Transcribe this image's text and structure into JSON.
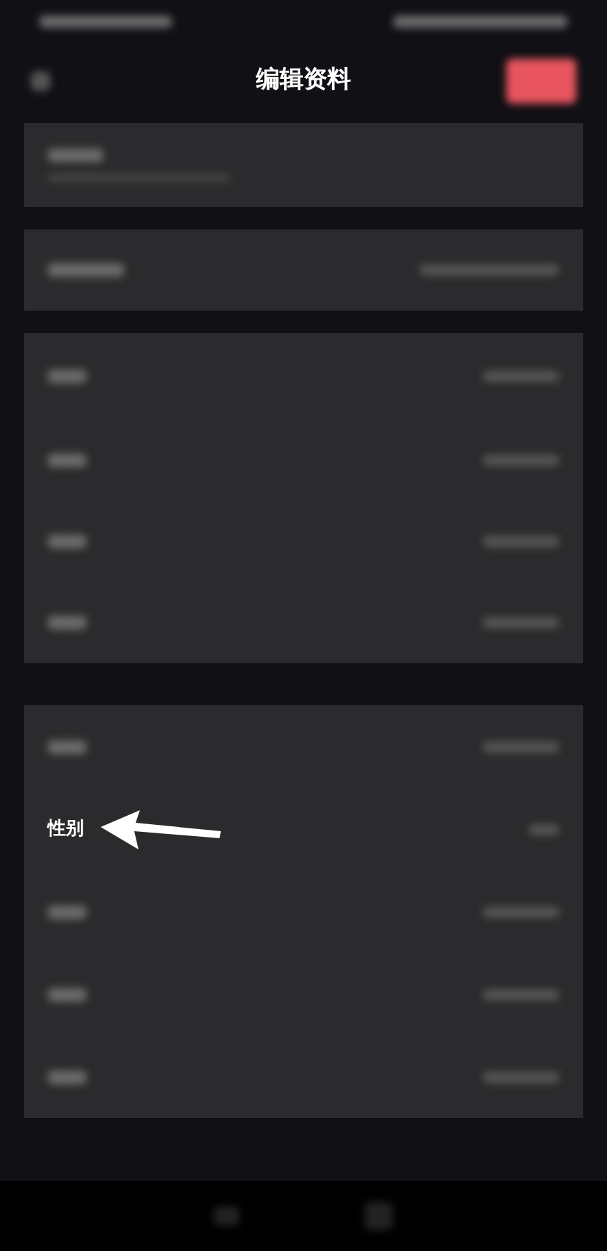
{
  "header": {
    "title": "编辑资料"
  },
  "sections": [
    {
      "rows": [
        {
          "kind": "blurred_two_line"
        }
      ]
    },
    {
      "rows": [
        {
          "kind": "blurred"
        }
      ]
    },
    {
      "rows": [
        {
          "kind": "blurred"
        },
        {
          "kind": "blurred"
        },
        {
          "kind": "blurred"
        },
        {
          "kind": "blurred"
        }
      ]
    },
    {
      "rows": [
        {
          "kind": "blurred"
        },
        {
          "kind": "label",
          "label": "性别",
          "annotated": true
        },
        {
          "kind": "blurred"
        },
        {
          "kind": "blurred"
        },
        {
          "kind": "blurred"
        }
      ]
    }
  ]
}
